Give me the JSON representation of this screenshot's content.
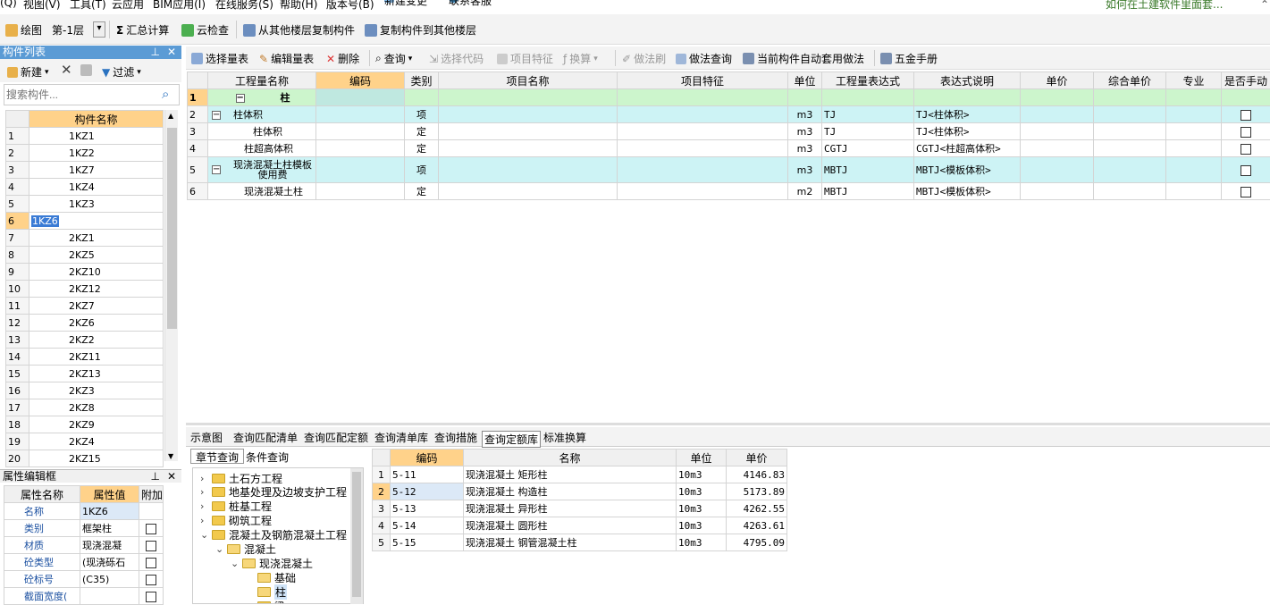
{
  "menu": {
    "items": [
      "(Q)",
      "视图(V)",
      "工具(T)",
      "云应用",
      "BIM应用(I)",
      "在线服务(S)",
      "帮助(H)",
      "版本号(B)",
      "新建变更",
      "联系客服"
    ],
    "help_link": "如何在土建软件里面套..."
  },
  "toolbar1": {
    "draw_label": "绘图",
    "floor_value": "第-1层",
    "summary_label": "汇总计算",
    "cloud_check_label": "云检查",
    "copy_from_label": "从其他楼层复制构件",
    "copy_to_label": "复制构件到其他楼层"
  },
  "component_list": {
    "title": "构件列表",
    "new_label": "新建",
    "filter_label": "过滤",
    "search_placeholder": "搜索构件...",
    "column_header": "构件名称",
    "rows": [
      {
        "num": "1",
        "name": "1KZ1"
      },
      {
        "num": "2",
        "name": "1KZ2"
      },
      {
        "num": "3",
        "name": "1KZ7"
      },
      {
        "num": "4",
        "name": "1KZ4"
      },
      {
        "num": "5",
        "name": "1KZ3"
      },
      {
        "num": "6",
        "name": "1KZ6"
      },
      {
        "num": "7",
        "name": "2KZ1"
      },
      {
        "num": "8",
        "name": "2KZ5"
      },
      {
        "num": "9",
        "name": "2KZ10"
      },
      {
        "num": "10",
        "name": "2KZ12"
      },
      {
        "num": "11",
        "name": "2KZ7"
      },
      {
        "num": "12",
        "name": "2KZ6"
      },
      {
        "num": "13",
        "name": "2KZ2"
      },
      {
        "num": "14",
        "name": "2KZ11"
      },
      {
        "num": "15",
        "name": "2KZ13"
      },
      {
        "num": "16",
        "name": "2KZ3"
      },
      {
        "num": "17",
        "name": "2KZ8"
      },
      {
        "num": "18",
        "name": "2KZ9"
      },
      {
        "num": "19",
        "name": "2KZ4"
      },
      {
        "num": "20",
        "name": "2KZ15"
      }
    ],
    "selected_row": "6"
  },
  "property_panel": {
    "title": "属性编辑框",
    "headers": [
      "属性名称",
      "属性值",
      "附加"
    ],
    "rows": [
      {
        "name": "名称",
        "value": "1KZ6",
        "check": false
      },
      {
        "name": "类别",
        "value": "框架柱",
        "check": true
      },
      {
        "name": "材质",
        "value": "现浇混凝",
        "check": true
      },
      {
        "name": "砼类型",
        "value": "(现浇砾石",
        "check": true
      },
      {
        "name": "砼标号",
        "value": "(C35)",
        "check": true
      },
      {
        "name": "截面宽度(",
        "value": "",
        "check": true
      }
    ]
  },
  "toolbar2": {
    "items": [
      "选择量表",
      "编辑量表",
      "删除",
      "查询",
      "选择代码",
      "项目特征",
      "换算",
      "做法刷",
      "做法查询",
      "当前构件自动套用做法",
      "五金手册"
    ]
  },
  "quantity_table": {
    "headers": [
      "工程量名称",
      "编码",
      "类别",
      "项目名称",
      "项目特征",
      "单位",
      "工程量表达式",
      "表达式说明",
      "单价",
      "综合单价",
      "专业",
      "是否手动"
    ],
    "rows": [
      {
        "num": "1",
        "name": "柱",
        "code": "",
        "type": "",
        "item": "",
        "feature": "",
        "unit": "",
        "expr": "",
        "desc": "",
        "check": false
      },
      {
        "num": "2",
        "name": "柱体积",
        "code": "",
        "type": "项",
        "item": "",
        "feature": "",
        "unit": "m3",
        "expr": "TJ",
        "desc": "TJ<柱体积>",
        "check": true
      },
      {
        "num": "3",
        "name": "柱体积",
        "code": "",
        "type": "定",
        "item": "",
        "feature": "",
        "unit": "m3",
        "expr": "TJ",
        "desc": "TJ<柱体积>",
        "check": true
      },
      {
        "num": "4",
        "name": "柱超高体积",
        "code": "",
        "type": "定",
        "item": "",
        "feature": "",
        "unit": "m3",
        "expr": "CGTJ",
        "desc": "CGTJ<柱超高体积>",
        "check": true
      },
      {
        "num": "5",
        "name": "现浇混凝土柱模板使用费",
        "code": "",
        "type": "项",
        "item": "",
        "feature": "",
        "unit": "m3",
        "expr": "MBTJ",
        "desc": "MBTJ<模板体积>",
        "check": true
      },
      {
        "num": "6",
        "name": "现浇混凝土柱",
        "code": "",
        "type": "定",
        "item": "",
        "feature": "",
        "unit": "m2",
        "expr": "MBTJ",
        "desc": "MBTJ<模板体积>",
        "check": true
      }
    ]
  },
  "bottom_tabs": [
    "示意图",
    "查询匹配清单",
    "查询匹配定额",
    "查询清单库",
    "查询措施",
    "查询定额库",
    "标准换算"
  ],
  "bottom_active_tab": "查询定额库",
  "chapter": {
    "tabs": [
      "章节查询",
      "条件查询"
    ],
    "tree": [
      "土石方工程",
      "地基处理及边坡支护工程",
      "桩基工程",
      "砌筑工程",
      "混凝土及钢筋混凝土工程",
      "混凝土",
      "现浇混凝土",
      "基础",
      "柱",
      "梁"
    ]
  },
  "quota_table": {
    "headers": [
      "编码",
      "名称",
      "单位",
      "单价"
    ],
    "rows": [
      {
        "num": "1",
        "code": "5-11",
        "name": "现浇混凝土 矩形柱",
        "unit": "10m3",
        "price": "4146.83"
      },
      {
        "num": "2",
        "code": "5-12",
        "name": "现浇混凝土 构造柱",
        "unit": "10m3",
        "price": "5173.89"
      },
      {
        "num": "3",
        "code": "5-13",
        "name": "现浇混凝土 异形柱",
        "unit": "10m3",
        "price": "4262.55"
      },
      {
        "num": "4",
        "code": "5-14",
        "name": "现浇混凝土 圆形柱",
        "unit": "10m3",
        "price": "4263.61"
      },
      {
        "num": "5",
        "code": "5-15",
        "name": "现浇混凝土 钢管混凝土柱",
        "unit": "10m3",
        "price": "4795.09"
      }
    ]
  },
  "colors": {
    "accent": "#5b9bd5",
    "header_selected": "#ffd28a",
    "row_cyan": "#cdf3f5",
    "row_green": "#ccf5cc"
  }
}
